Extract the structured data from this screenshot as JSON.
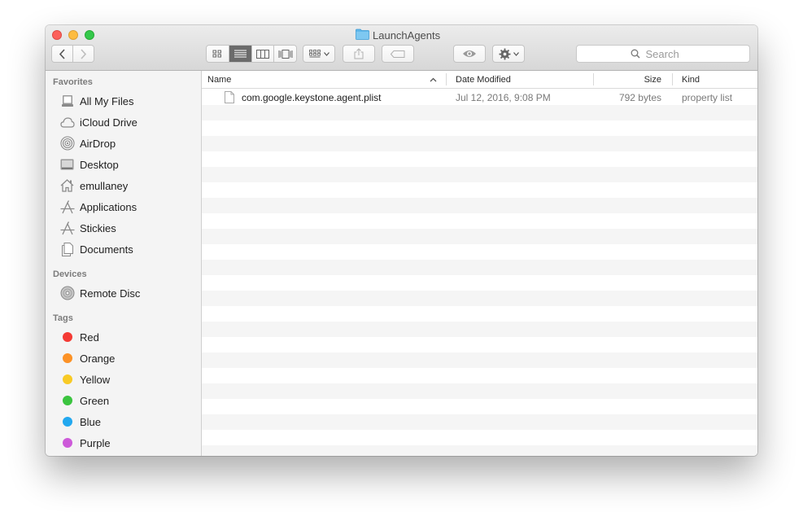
{
  "window": {
    "title": "LaunchAgents"
  },
  "toolbar": {
    "search_placeholder": "Search"
  },
  "sidebar": {
    "favorites_header": "Favorites",
    "favorites": [
      {
        "label": "All My Files",
        "icon": "all-files-icon"
      },
      {
        "label": "iCloud Drive",
        "icon": "cloud-icon"
      },
      {
        "label": "AirDrop",
        "icon": "airdrop-icon"
      },
      {
        "label": "Desktop",
        "icon": "desktop-icon"
      },
      {
        "label": "emullaney",
        "icon": "home-icon"
      },
      {
        "label": "Applications",
        "icon": "applications-icon"
      },
      {
        "label": "Stickies",
        "icon": "applications-icon"
      },
      {
        "label": "Documents",
        "icon": "documents-icon"
      }
    ],
    "devices_header": "Devices",
    "devices": [
      {
        "label": "Remote Disc",
        "icon": "disc-icon"
      }
    ],
    "tags_header": "Tags",
    "tags": [
      {
        "label": "Red",
        "color": "#f43a34"
      },
      {
        "label": "Orange",
        "color": "#fc9226"
      },
      {
        "label": "Yellow",
        "color": "#f8ca25"
      },
      {
        "label": "Green",
        "color": "#3bc43f"
      },
      {
        "label": "Blue",
        "color": "#22a8ef"
      },
      {
        "label": "Purple",
        "color": "#cd5ad9"
      }
    ]
  },
  "columns": {
    "name": "Name",
    "date": "Date Modified",
    "size": "Size",
    "kind": "Kind"
  },
  "files": [
    {
      "name": "com.google.keystone.agent.plist",
      "date": "Jul 12, 2016, 9:08 PM",
      "size": "792 bytes",
      "kind": "property list",
      "icon": "document-icon"
    }
  ]
}
